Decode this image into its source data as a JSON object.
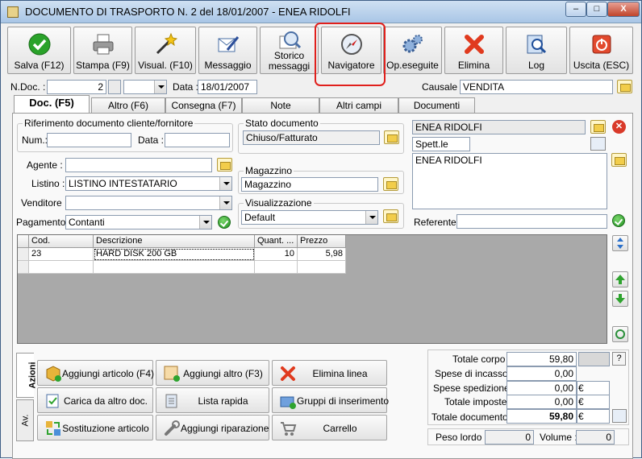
{
  "window": {
    "title": "DOCUMENTO DI TRASPORTO N. 2  del 18/01/2007 - ENEA RIDOLFI",
    "min": "–",
    "max": "□",
    "close": "X"
  },
  "toolbar": [
    {
      "label": "Salva (F12)",
      "icon": "save-check-icon"
    },
    {
      "label": "Stampa (F9)",
      "icon": "printer-icon"
    },
    {
      "label": "Visual. (F10)",
      "icon": "magic-wand-icon"
    },
    {
      "label": "Messaggio",
      "icon": "message-pen-icon"
    },
    {
      "label": "Storico messaggi",
      "icon": "message-history-icon"
    },
    {
      "label": "Navigatore",
      "icon": "compass-icon"
    },
    {
      "label": "Op.eseguite",
      "icon": "gears-icon"
    },
    {
      "label": "Elimina",
      "icon": "delete-x-icon"
    },
    {
      "label": "Log",
      "icon": "log-search-icon"
    },
    {
      "label": "Uscita (ESC)",
      "icon": "exit-power-icon"
    }
  ],
  "header": {
    "ndoc_label": "N.Doc. :",
    "ndoc_value": "2",
    "data_label": "Data :",
    "data_value": "18/01/2007",
    "causale_label": "Causale :",
    "causale_value": "VENDITA"
  },
  "tabs": [
    "Doc. (F5)",
    "Altro (F6)",
    "Consegna (F7)",
    "Note",
    "Altri campi",
    "Documenti"
  ],
  "rif": {
    "title": "Riferimento documento cliente/fornitore",
    "num_label": "Num.:",
    "num_value": "",
    "data_label": "Data :",
    "data_value": ""
  },
  "fields": {
    "agente_label": "Agente :",
    "agente_value": "",
    "listino_label": "Listino :",
    "listino_value": "LISTINO INTESTATARIO",
    "venditore_label": "Venditore :",
    "venditore_value": "",
    "pagamento_label": "Pagamento :",
    "pagamento_value": "Contanti"
  },
  "stato": {
    "title": "Stato documento",
    "value": "Chiuso/Fatturato"
  },
  "magazzino": {
    "title": "Magazzino",
    "value": "Magazzino"
  },
  "visualizzazione": {
    "title": "Visualizzazione",
    "value": "Default"
  },
  "cliente": {
    "name": "ENEA RIDOLFI",
    "title": "Spett.le",
    "address": "ENEA RIDOLFI",
    "referente_label": "Referente :",
    "referente_value": ""
  },
  "grid": {
    "headers": [
      "Cod.",
      "Descrizione",
      "Quant. ...",
      "Prezzo"
    ],
    "rows": [
      [
        "23",
        "HARD DISK 200 GB",
        "10",
        "5,98"
      ]
    ]
  },
  "azioni": {
    "tab_azioni": "Azioni",
    "tab_av": "Av.",
    "buttons": [
      {
        "label": "Aggiungi articolo (F4)",
        "icon": "add-article-icon"
      },
      {
        "label": "Aggiungi altro (F3)",
        "icon": "add-other-icon"
      },
      {
        "label": "Elimina linea",
        "icon": "delete-line-icon"
      },
      {
        "label": "Carica da altro doc.",
        "icon": "load-doc-icon"
      },
      {
        "label": "Lista rapida",
        "icon": "quick-list-icon"
      },
      {
        "label": "Gruppi di inserimento",
        "icon": "insert-groups-icon"
      },
      {
        "label": "Sostituzione articolo",
        "icon": "replace-article-icon"
      },
      {
        "label": "Aggiungi riparazione",
        "icon": "wrench-icon"
      },
      {
        "label": "Carrello",
        "icon": "cart-icon"
      }
    ]
  },
  "totali": {
    "corpo_label": "Totale corpo :",
    "corpo_value": "59,80",
    "help": "?",
    "incasso_label": "Spese di incasso :",
    "incasso_value": "0,00",
    "spedizione_label": "Spese spedizione :",
    "spedizione_value": "0,00",
    "currency": "€",
    "imposte_label": "Totale imposte :",
    "imposte_value": "0,00",
    "documento_label": "Totale documento :",
    "documento_value": "59,80"
  },
  "pesi": {
    "lordo_label": "Peso lordo :",
    "lordo_value": "0",
    "volume_label": "Volume :",
    "volume_value": "0"
  }
}
